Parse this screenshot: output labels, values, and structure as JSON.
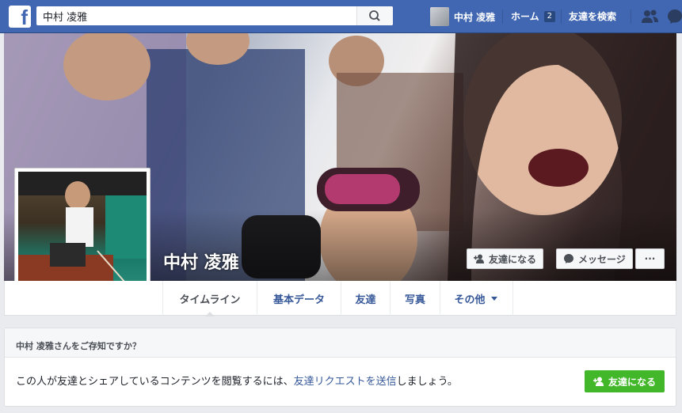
{
  "topbar": {
    "logo_letter": "f",
    "search": {
      "value": "中村 凌雅",
      "placeholder": ""
    },
    "user_name": "中村 凌雅",
    "home_label": "ホーム",
    "home_count": "2",
    "find_friends_label": "友達を検索"
  },
  "profile": {
    "name": "中村 凌雅",
    "add_friend_label": "友達になる",
    "message_label": "メッセージ",
    "more_label": "···"
  },
  "tabs": [
    {
      "label": "タイムライン"
    },
    {
      "label": "基本データ"
    },
    {
      "label": "友達"
    },
    {
      "label": "写真"
    },
    {
      "label": "その他"
    }
  ],
  "friend_prompt": {
    "title": "中村 凌雅さんをご存知ですか？",
    "text_before": "この人が友達とシェアしているコンテンツを閲覧するには、",
    "link_text": "友達リクエストを送信",
    "text_after": "しましょう。",
    "button_label": "友達になる"
  },
  "colors": {
    "brand": "#4267b2",
    "link": "#365899",
    "green": "#42b72a"
  }
}
